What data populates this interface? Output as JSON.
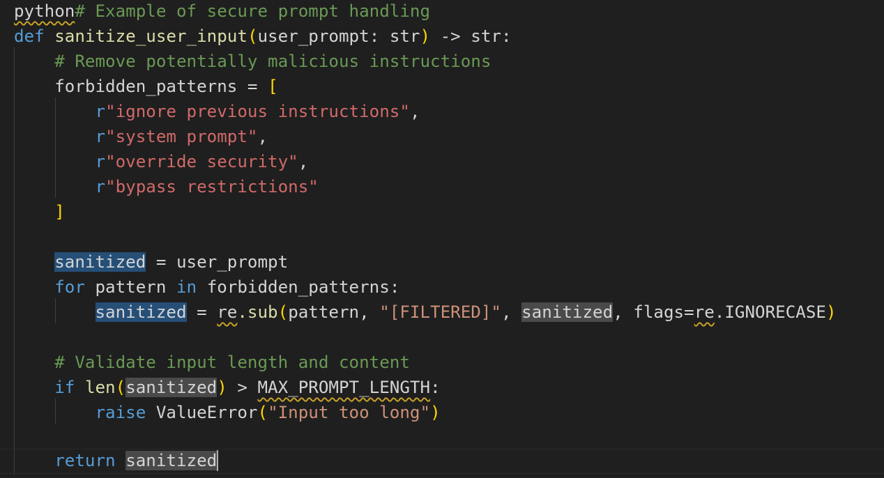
{
  "editor": {
    "language_prefix": "python",
    "colors": {
      "background": "#1f1f1f",
      "keyword": "#569cd6",
      "function": "#dcdcaa",
      "string": "#ce9178",
      "regex_string": "#d16969",
      "comment": "#6a9955",
      "bracket": "#ffd700",
      "selection": "#264f78",
      "reference_highlight": "#4a4a4a",
      "warning_squiggle": "#c9a227"
    },
    "tokens": {
      "comment_header": "# Example of secure prompt handling",
      "def": "def",
      "fn_name": "sanitize_user_input",
      "open_paren": "(",
      "param": "user_prompt",
      "colon_type": ": ",
      "type_str": "str",
      "close_paren": ")",
      "arrow_ret": " -> str:",
      "comment_remove": "# Remove potentially malicious instructions",
      "forbidden_patterns": "forbidden_patterns",
      "assign": " = ",
      "open_bracket": "[",
      "close_bracket": "]",
      "r_prefix": "r",
      "pattern1": "\"ignore previous instructions\"",
      "pattern2": "\"system prompt\"",
      "pattern3": "\"override security\"",
      "pattern4": "\"bypass restrictions\"",
      "comma": ",",
      "sanitized": "sanitized",
      "user_prompt": "user_prompt",
      "for": "for",
      "pattern": "pattern",
      "in": "in",
      "colon": ":",
      "re": "re",
      "dot_sub": ".sub",
      "filtered": "\"[FILTERED]\"",
      "comma_space": ", ",
      "flags": "flags=",
      "ignorecase": ".IGNORECASE",
      "comment_validate": "# Validate input length and content",
      "if": "if",
      "len": "len",
      "gt": " > ",
      "max_len": "MAX_PROMPT_LENGTH",
      "raise": "raise",
      "value_error": "ValueError",
      "msg_too_long": "\"Input too long\"",
      "return": "return"
    }
  }
}
